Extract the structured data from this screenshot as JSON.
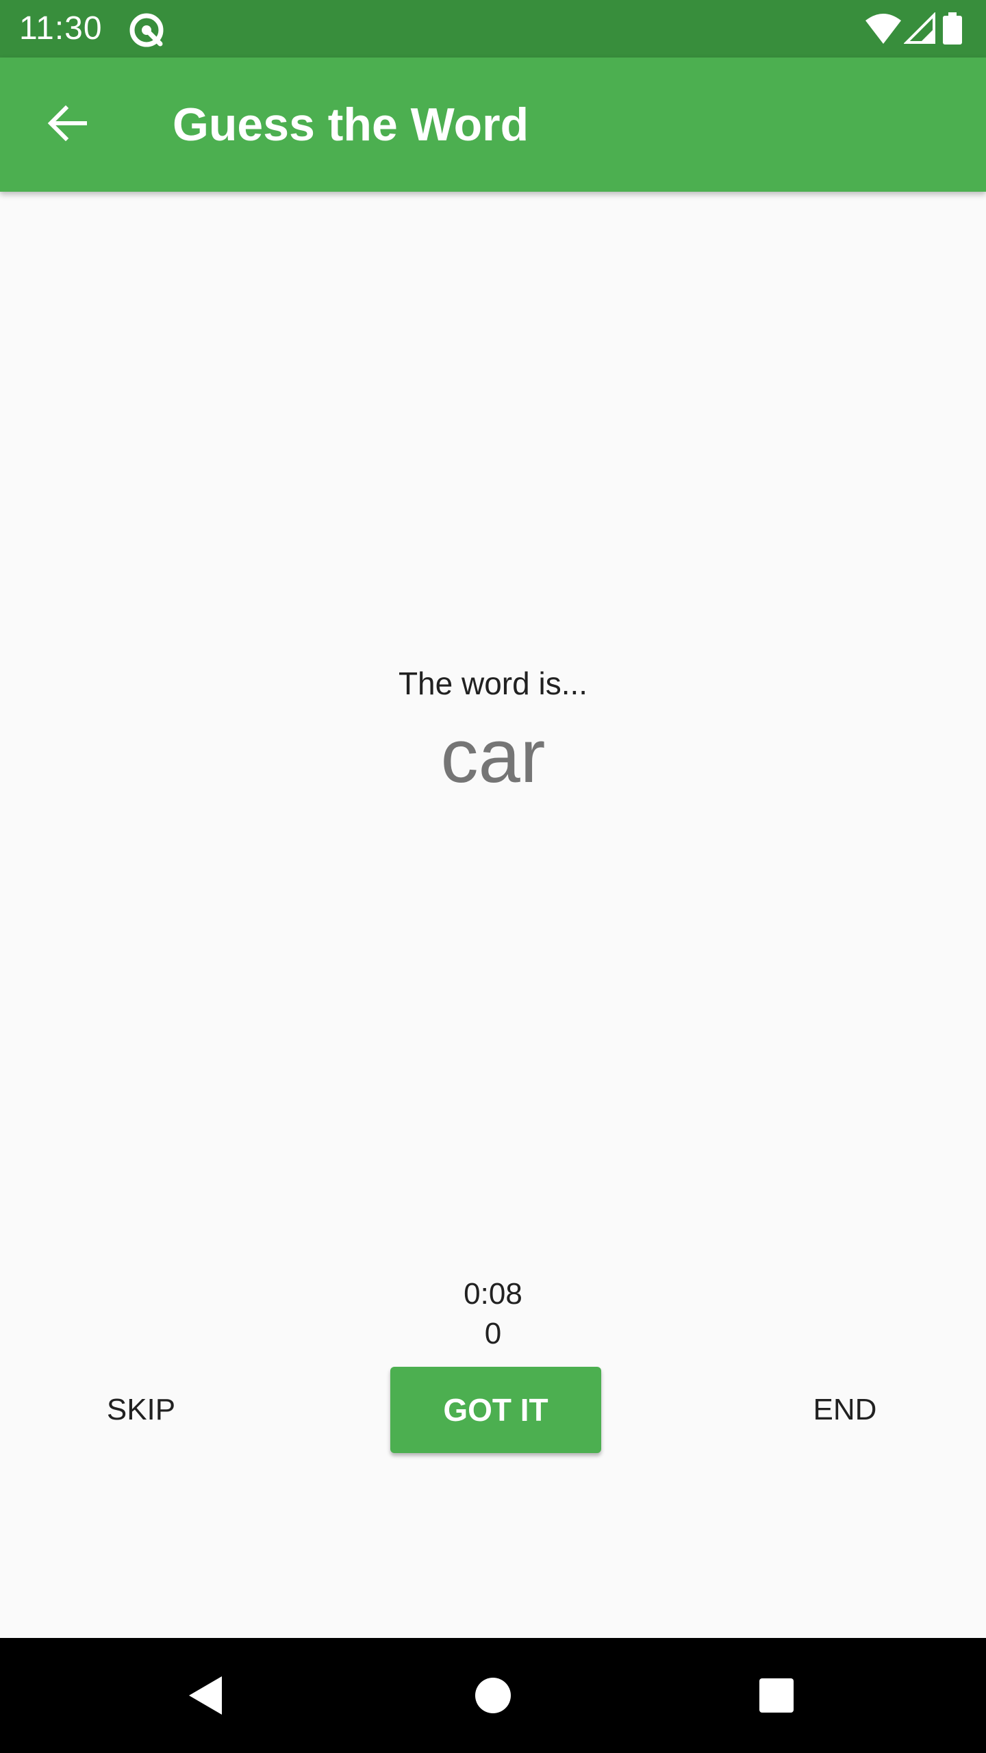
{
  "status_bar": {
    "time": "11:30",
    "icons": [
      "app-notification-icon",
      "wifi-icon",
      "cell-signal-icon",
      "battery-icon"
    ]
  },
  "app_bar": {
    "title": "Guess the Word",
    "back_icon": "arrow-back-icon"
  },
  "game": {
    "word_label": "The word is...",
    "word": "car",
    "timer": "0:08",
    "score": "0"
  },
  "actions": {
    "skip_label": "SKIP",
    "got_it_label": "GOT IT",
    "end_label": "END"
  },
  "nav_bar": {
    "icons": [
      "nav-back-icon",
      "nav-home-icon",
      "nav-recents-icon"
    ]
  },
  "colors": {
    "status_bar": "#388e3c",
    "app_bar": "#4caf50",
    "accent_button": "#4caf50",
    "background": "#fafafa",
    "word_text": "#757575"
  }
}
